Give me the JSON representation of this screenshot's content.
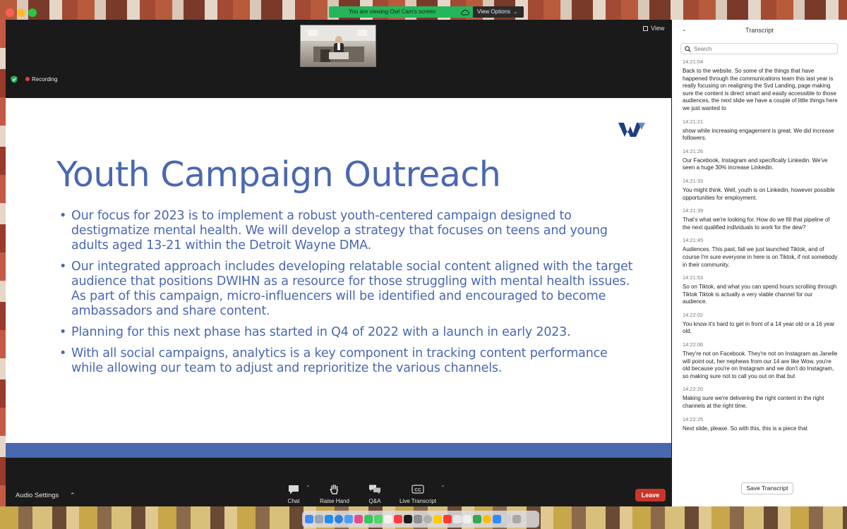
{
  "banner": {
    "sharing_text": "You are viewing Owl Cam's screen",
    "view_options": "View Options"
  },
  "meeting": {
    "view_label": "View",
    "recording_label": "Recording"
  },
  "slide": {
    "title": "Youth Campaign Outreach",
    "bullets": [
      "Our focus for 2023 is to implement a robust youth-centered campaign designed to destigmatize mental health. We will develop a strategy that focuses on teens and young adults aged 13-21 within the Detroit Wayne DMA.",
      "Our integrated approach includes developing relatable social content aligned with the target audience that positions DWIHN as a resource for those struggling with mental health issues. As part of this campaign, micro-influencers will be identified and encouraged to become ambassadors and share content.",
      "Planning for this next phase has started in Q4 of 2022 with a launch in early 2023.",
      "With all social campaigns, analytics is a key component in tracking content performance while allowing our team to adjust and reprioritize the various channels."
    ]
  },
  "toolbar": {
    "audio_settings": "Audio Settings",
    "chat": "Chat",
    "raise_hand": "Raise Hand",
    "qa": "Q&A",
    "live_transcript": "Live Transcript",
    "cc_badge": "CC",
    "leave": "Leave"
  },
  "transcript": {
    "title": "Transcript",
    "search_placeholder": "Search",
    "save_button": "Save Transcript",
    "entries": [
      {
        "time": "14:21:04",
        "text": "Back to the website. So some of the things that have happened through the communications team this last year is really focusing on realigning the Svd Landing, page making sure the content is direct smart and easily accessible to those audiences, the next slide we have a couple of little things here we just wanted to"
      },
      {
        "time": "14:21:21",
        "text": "show while increasing engagement is great. We did increase followers."
      },
      {
        "time": "14:21:26",
        "text": "Our Facebook, Instagram and specifically Linkedin. We've seen a huge 30% increase Linkedin."
      },
      {
        "time": "14:21:33",
        "text": "You might think. Well, youth is on Linkedin, however possible opportunities for employment."
      },
      {
        "time": "14:21:39",
        "text": "That's what we're looking for. How do we fill that pipeline of the next qualified individuals to work for the dew?"
      },
      {
        "time": "14:21:45",
        "text": "Audiences. This past, fall we just launched Tiktok, and of course I'm sure everyone in here is on Tiktok, if not somebody in their community."
      },
      {
        "time": "14:21:53",
        "text": "So on Tiktok, and what you can spend hours scrolling through Tiktok Tiktok is actually a very viable channel for our audience."
      },
      {
        "time": "14:22:02",
        "text": "You know it's hard to get in front of a 14 year old or a 16 year old."
      },
      {
        "time": "14:22:06",
        "text": "They're not on Facebook. They're not on Instagram as Janelle will point out, her nephews from our 14 are like Wow, you're old because you're on Instagram and we don't do Instagram, so making sure not to call you out on that but"
      },
      {
        "time": "14:22:20",
        "text": "Making sure we're delivering the right content in the right channels at the right time."
      },
      {
        "time": "14:22:25",
        "text": "Next slide, please. So with this, this is a piece that"
      }
    ]
  },
  "colors": {
    "slide_accent": "#4a68b0",
    "share_banner": "#25b55a",
    "leave_button": "#c9352b",
    "recording_dot": "#e0453a"
  }
}
